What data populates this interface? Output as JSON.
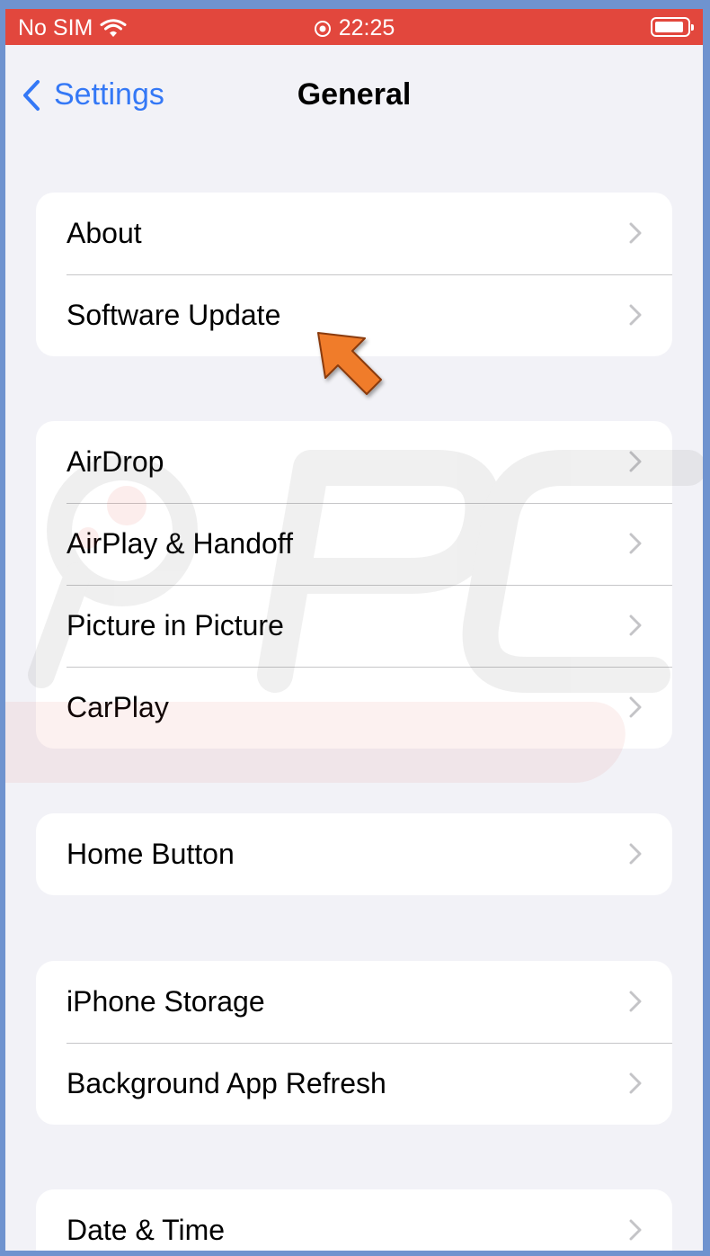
{
  "status_bar": {
    "carrier": "No SIM",
    "time": "22:25",
    "icons": [
      "wifi-icon",
      "orientation-lock-icon",
      "battery-icon"
    ]
  },
  "nav": {
    "back_label": "Settings",
    "title": "General"
  },
  "groups": [
    {
      "items": [
        {
          "label": "About"
        },
        {
          "label": "Software Update"
        }
      ]
    },
    {
      "items": [
        {
          "label": "AirDrop"
        },
        {
          "label": "AirPlay & Handoff"
        },
        {
          "label": "Picture in Picture"
        },
        {
          "label": "CarPlay"
        }
      ]
    },
    {
      "items": [
        {
          "label": "Home Button"
        }
      ]
    },
    {
      "items": [
        {
          "label": "iPhone Storage"
        },
        {
          "label": "Background App Refresh"
        }
      ]
    },
    {
      "items": [
        {
          "label": "Date & Time"
        }
      ]
    }
  ],
  "annotation": {
    "icon": "pointer-arrow-icon",
    "color": "#f07b2c"
  },
  "colors": {
    "accent": "#3478f6",
    "status_bar": "#e2473d",
    "frame": "#6f93cf",
    "background": "#f2f2f7"
  }
}
